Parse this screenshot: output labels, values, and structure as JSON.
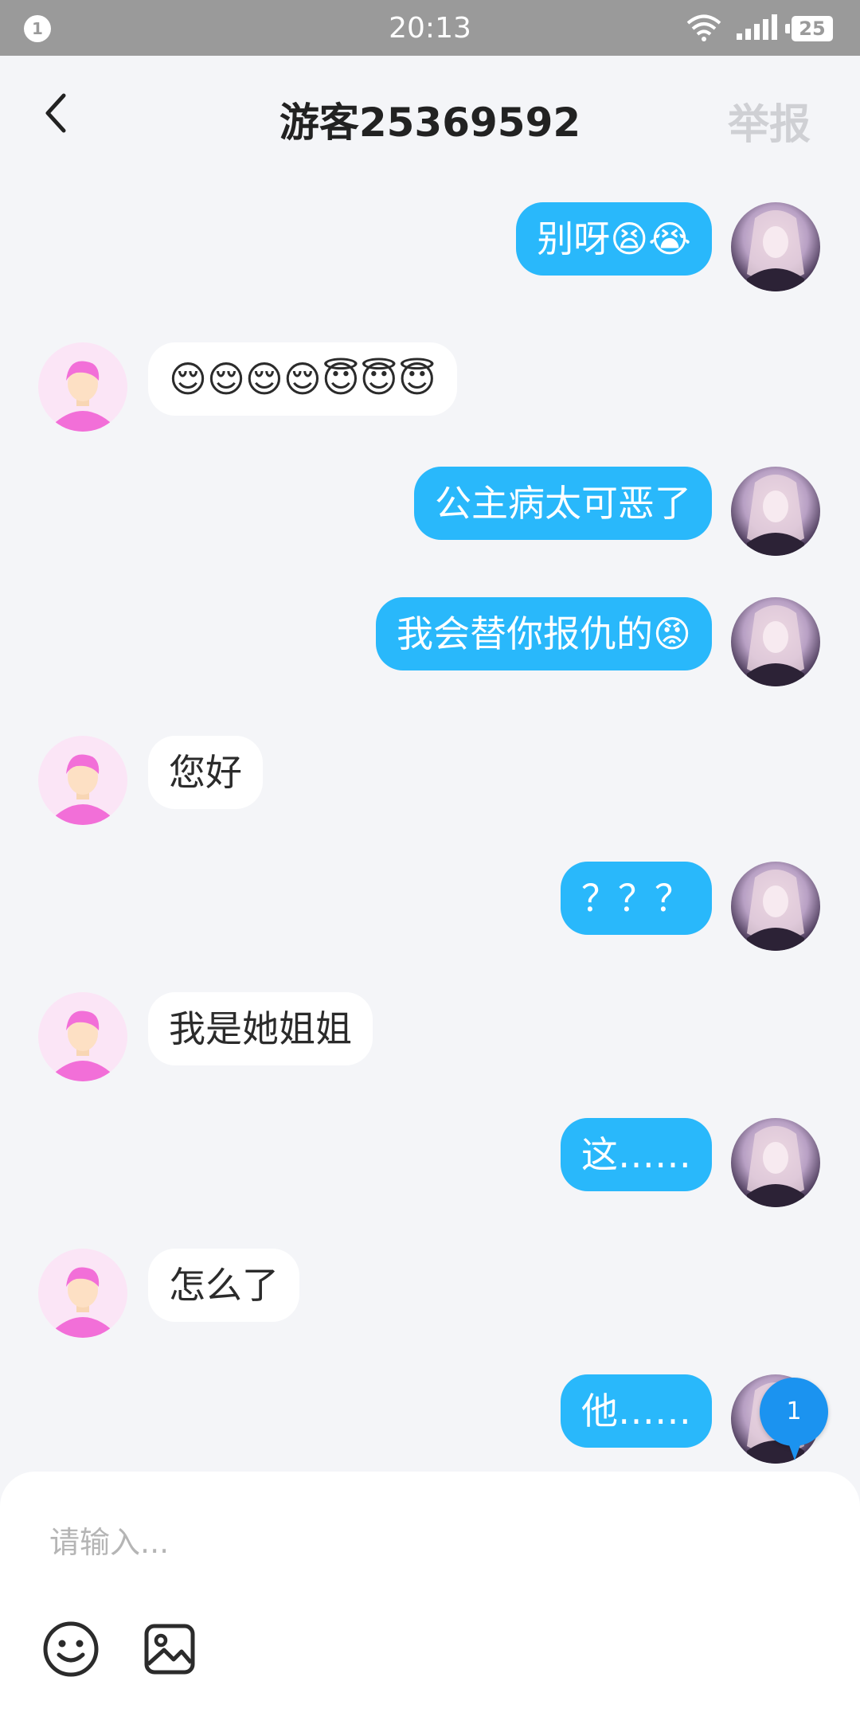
{
  "status_bar": {
    "notification_count": "1",
    "time": "20:13",
    "battery": "25",
    "icons": [
      "wifi-icon",
      "signal-icon",
      "battery-icon"
    ]
  },
  "header": {
    "title": "游客25369592",
    "report_label": "举报",
    "back_icon": "chevron-left-icon"
  },
  "messages": [
    {
      "direction": "out",
      "text": "别呀😫😭"
    },
    {
      "direction": "in",
      "text": "😌😌😌😌😇😇😇"
    },
    {
      "direction": "out",
      "text": "公主病太可恶了"
    },
    {
      "direction": "out",
      "text": "我会替你报仇的😡"
    },
    {
      "direction": "in",
      "text": "您好"
    },
    {
      "direction": "out",
      "text": "？？？"
    },
    {
      "direction": "in",
      "text": "我是她姐姐"
    },
    {
      "direction": "out",
      "text": "这……"
    },
    {
      "direction": "in",
      "text": "怎么了"
    },
    {
      "direction": "out",
      "text": "他……"
    }
  ],
  "unread_badge": "1",
  "composer": {
    "placeholder": "请输入...",
    "emoji_icon": "smiley-icon",
    "image_icon": "image-icon"
  },
  "colors": {
    "outgoing_bubble": "#29b8fb",
    "incoming_bubble": "#ffffff",
    "background": "#f4f5f8",
    "status_bar": "#9a9a9a"
  }
}
